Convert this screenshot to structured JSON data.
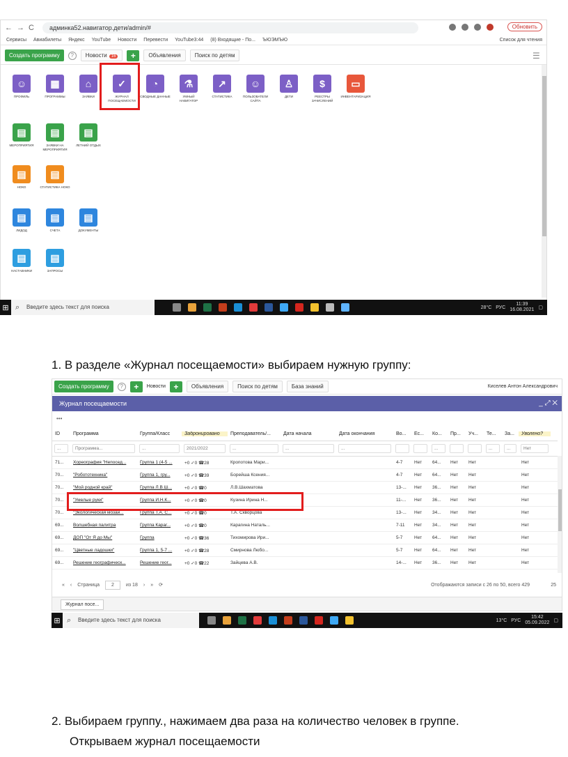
{
  "screenshot1": {
    "url": "админка52.навигатор.дети/admin/#",
    "update_button": "Обновить",
    "bookmarks": [
      "Сервисы",
      "Авиабилеты",
      "Яндекс",
      "YouTube",
      "Новости",
      "Перевести",
      "YouTube3:44",
      "(8) Входящие - По...",
      "ЪЮЭМЪЮ"
    ],
    "reading_list": "Список для чтения",
    "toolbar": {
      "create": "Создать программу",
      "news": "Новости",
      "news_badge": "16",
      "ads": "Объявления",
      "search_children": "Поиск по детям"
    },
    "tiles_row1": [
      "ПРОФИЛЬ",
      "ПРОГРАММЫ",
      "ЗАЯВКИ",
      "ЖУРНАЛ ПОСЕЩАЕМОСТИ",
      "СВОДНЫЕ ДАННЫЕ",
      "УМНЫЙ НАВИГАТОР",
      "СТАТИСТИКА",
      "ПОЛЬЗОВАТЕЛИ САЙТА",
      "ДЕТИ",
      "РЕЕСТРЫ ЗАЧИСЛЕНИЙ",
      "ИНВЕНТАРИЗАЦИЯ"
    ],
    "tiles_row2": [
      "МЕРОПРИЯТИЯ",
      "ЗАЯВКИ НА МЕРОПРИЯТИЯ",
      "ЛЕТНИЙ ОТДЫХ"
    ],
    "tiles_row3": [
      "НОКО",
      "СТАТИСТИКА НОКО"
    ],
    "tiles_row4": [
      "ЛИДОД",
      "СЧЕТА",
      "ДОКУМЕНТЫ"
    ],
    "tiles_row5": [
      "НАСТАВНИКИ",
      "ЗАПРОСЫ"
    ],
    "taskbar": {
      "search": "Введите здесь текст для поиска",
      "temp": "28°C",
      "lang": "РУС",
      "time": "11:39",
      "date": "16.08.2021"
    }
  },
  "caption1": "1.  В разделе «Журнал посещаемости» выбираем нужную группу:",
  "screenshot2": {
    "toolbar": {
      "create": "Создать программу",
      "news": "Новости",
      "ads": "Объявления",
      "search_children": "Поиск по детям",
      "knowledge": "База знаний",
      "user": "Киселев Антон Александрович"
    },
    "panel_title": "Журнал посещаемости",
    "headers": [
      "ID",
      "Программа",
      "Группа/Класс",
      "Забронировано",
      "Преподаватель/...",
      "Дата начала",
      "Дата окончания",
      "Во...",
      "Ес...",
      "Ко...",
      "Пр...",
      "Уч...",
      "Те...",
      "За...",
      "Уволено?"
    ],
    "filters": [
      "...",
      "Программа...",
      "...",
      "2021/2022",
      "...",
      "...",
      "...",
      "",
      "",
      "...",
      "",
      "",
      "...",
      "...",
      "Нет"
    ],
    "rows": [
      {
        "id": "71...",
        "prog": "Хореография \"Непосед...",
        "grp": "Группа 1 (4-5 ...",
        "bk": "+0 ✓0 ☎28",
        "teacher": "Кропотова Мари...",
        "age": "4-7",
        "e": "Нет",
        "k": "64...",
        "p": "Нет",
        "u": "Нет",
        "fired": "Нет"
      },
      {
        "id": "70...",
        "prog": "\"Робототехника\"",
        "grp": "Группа 1, гру...",
        "bk": "+0 ✓0 ☎39",
        "teacher": "Борейша Ксения...",
        "age": "4-7",
        "e": "Нет",
        "k": "64...",
        "p": "Нет",
        "u": "Нет",
        "fired": "Нет"
      },
      {
        "id": "70...",
        "prog": "\"Мой родной край\"",
        "grp": "Группа Л.В.Ш...",
        "bk": "+0 ✓0 ☎0",
        "teacher": "Л.В.Шахматова",
        "age": "13-...",
        "e": "Нет",
        "k": "36...",
        "p": "Нет",
        "u": "Нет",
        "fired": "Нет"
      },
      {
        "id": "70...",
        "prog": "\"Умелые руки\"",
        "grp": "Группа И.Н.К...",
        "bk": "+0 ✓0 ☎0",
        "teacher": "Кузина Ирина Н...",
        "age": "11-...",
        "e": "Нет",
        "k": "36...",
        "p": "Нет",
        "u": "Нет",
        "fired": "Нет"
      },
      {
        "id": "70...",
        "prog": "\"Экологическая мозаи...",
        "grp": "Группа Т.А. С...",
        "bk": "+0 ✓0 ☎0",
        "teacher": "Т.А. Скворцова",
        "age": "13-...",
        "e": "Нет",
        "k": "34...",
        "p": "Нет",
        "u": "Нет",
        "fired": "Нет"
      },
      {
        "id": "69...",
        "prog": "Волшебная палитра",
        "grp": "Группа Карaг...",
        "bk": "+0 ✓0 ☎0",
        "teacher": "Карагина Наталь...",
        "age": "7-11",
        "e": "Нет",
        "k": "34...",
        "p": "Нет",
        "u": "Нет",
        "fired": "Нет"
      },
      {
        "id": "69...",
        "prog": "ДОП \"От Я до Мы\"",
        "grp": "Группа",
        "bk": "+0 ✓0 ☎36",
        "teacher": "Тихомирова Ири...",
        "age": "5-7",
        "e": "Нет",
        "k": "64...",
        "p": "Нет",
        "u": "Нет",
        "fired": "Нет"
      },
      {
        "id": "69...",
        "prog": "\"Цветные ладошки\"",
        "grp": "Группа 1, 5-7 ...",
        "bk": "+0 ✓0 ☎28",
        "teacher": "Смирнова Любо...",
        "age": "5-7",
        "e": "Нет",
        "k": "64...",
        "p": "Нет",
        "u": "Нет",
        "fired": "Нет"
      },
      {
        "id": "69...",
        "prog": "Решение географическ...",
        "grp": "Решение геог...",
        "bk": "+0 ✓0 ☎22",
        "teacher": "Зайцева А.В.",
        "age": "14-...",
        "e": "Нет",
        "k": "36...",
        "p": "Нет",
        "u": "Нет",
        "fired": "Нет"
      }
    ],
    "pager": {
      "page_label": "Страница",
      "page": "2",
      "of": "из 18",
      "info": "Отображаются записи с 26 по 50, всего 429",
      "size": "25"
    },
    "tab": "Журнал посе...",
    "taskbar": {
      "search": "Введите здесь текст для поиска",
      "temp": "13°C",
      "lang": "РУС",
      "time": "15:42",
      "date": "05.09.2022"
    }
  },
  "caption2_line1": "2.  Выбираем группу., нажимаем два раза на количество человек в группе.",
  "caption2_line2": "Открываем журнал посещаемости"
}
